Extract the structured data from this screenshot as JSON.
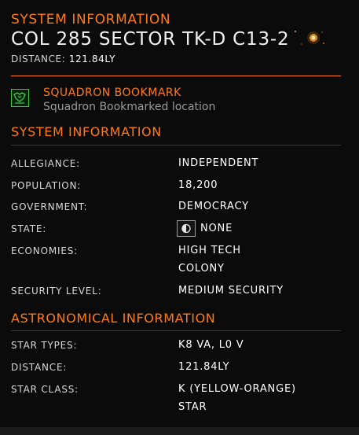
{
  "header": {
    "title": "SYSTEM INFORMATION",
    "system_name": "COL 285 SECTOR TK-D C13-2",
    "distance_label": "DISTANCE:",
    "distance_value": "121.84LY"
  },
  "bookmark": {
    "icon": "squadron-bookmark-icon",
    "title": "SQUADRON BOOKMARK",
    "subtitle": "Squadron Bookmarked location"
  },
  "system_info": {
    "heading": "SYSTEM INFORMATION",
    "rows": [
      {
        "label": "ALLEGIANCE:",
        "value": "INDEPENDENT"
      },
      {
        "label": "POPULATION:",
        "value": "18,200"
      },
      {
        "label": "GOVERNMENT:",
        "value": "DEMOCRACY"
      },
      {
        "label": "STATE:",
        "value": "NONE"
      },
      {
        "label": "ECONOMIES:",
        "value": "HIGH TECH",
        "value2": "COLONY"
      },
      {
        "label": "SECURITY LEVEL:",
        "value": "MEDIUM SECURITY"
      }
    ]
  },
  "astro_info": {
    "heading": "ASTRONOMICAL INFORMATION",
    "rows": [
      {
        "label": "STAR TYPES:",
        "value": "K8 VA, L0 V"
      },
      {
        "label": "DISTANCE:",
        "value": "121.84LY"
      },
      {
        "label": "STAR CLASS:",
        "value": "K (YELLOW-ORANGE)",
        "value2": "STAR"
      }
    ]
  },
  "colors": {
    "accent": "#ff7a10",
    "bookmark_green": "#43c24a",
    "background": "#0b0b0b"
  }
}
